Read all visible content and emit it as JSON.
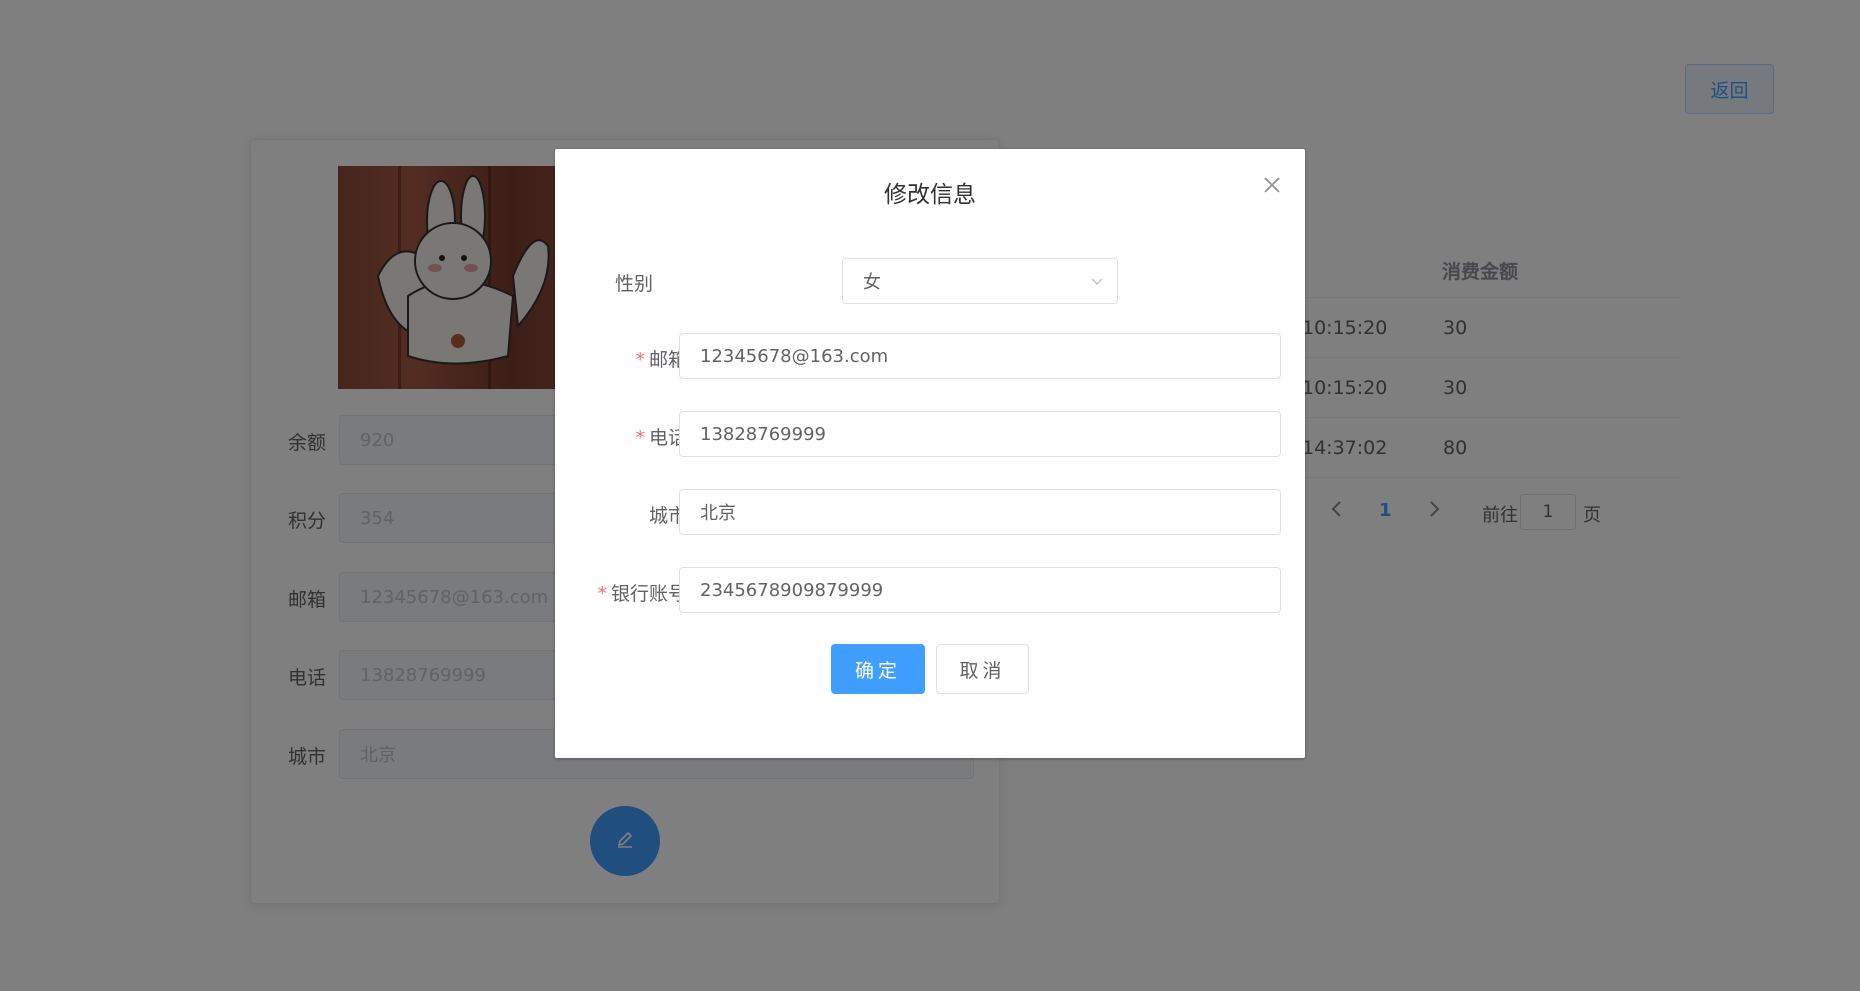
{
  "header": {
    "back_label": "返回"
  },
  "profile": {
    "fields": [
      {
        "label": "余额",
        "value": "920"
      },
      {
        "label": "积分",
        "value": "354"
      },
      {
        "label": "邮箱",
        "value": "12345678@163.com"
      },
      {
        "label": "电话",
        "value": "13828769999"
      },
      {
        "label": "城市",
        "value": "北京"
      }
    ],
    "edit_icon": "pencil-icon"
  },
  "records": {
    "amount_header": "消费金额",
    "rows": [
      {
        "time": "10:15:20",
        "amount": "30"
      },
      {
        "time": "10:15:20",
        "amount": "30"
      },
      {
        "time": "14:37:02",
        "amount": "80"
      }
    ]
  },
  "pagination": {
    "current_page": "1",
    "goto_prefix": "前往",
    "goto_value": "1",
    "goto_suffix": "页",
    "prev_icon": "chevron-left-icon",
    "next_icon": "chevron-right-icon"
  },
  "dialog": {
    "title": "修改信息",
    "close_icon": "close-icon",
    "gender": {
      "label": "性别",
      "value": "女"
    },
    "email": {
      "label": "邮箱",
      "value": "12345678@163.com"
    },
    "phone": {
      "label": "电话",
      "value": "13828769999"
    },
    "city": {
      "label": "城市",
      "value": "北京"
    },
    "bank_account": {
      "label": "银行账号",
      "value": "2345678909879999"
    },
    "required_mark": "*",
    "confirm_label": "确定",
    "cancel_label": "取消"
  },
  "colors": {
    "primary": "#409eff",
    "danger": "#f56c6c",
    "overlay": "rgba(0,0,0,0.5)"
  }
}
